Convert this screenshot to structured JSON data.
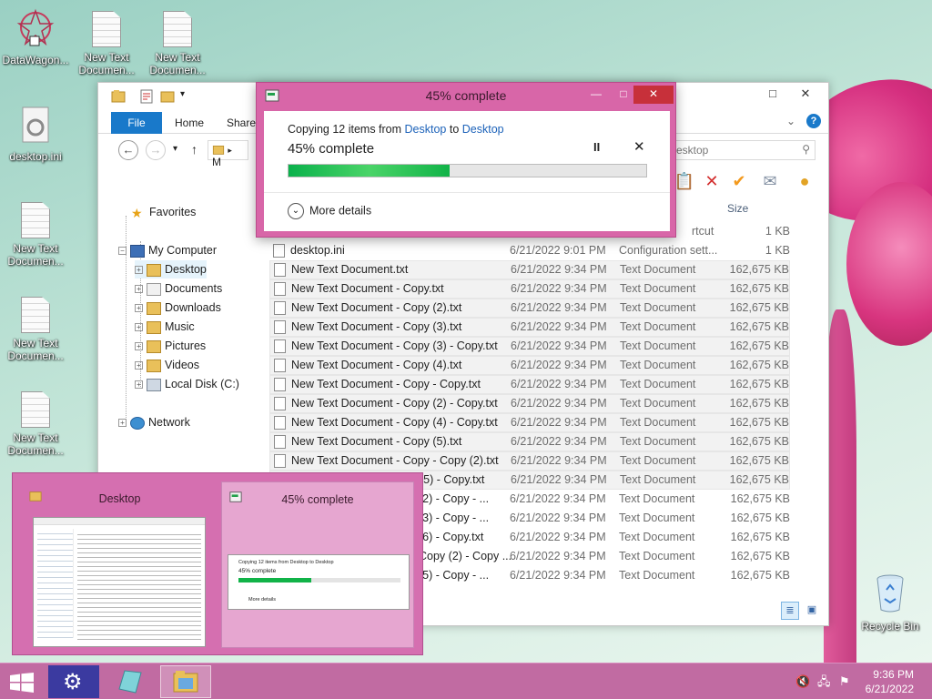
{
  "desktop": {
    "icons": [
      {
        "label": "DataWagon..."
      },
      {
        "label": "New Text Documen..."
      },
      {
        "label": "New Text Documen..."
      },
      {
        "label": "desktop.ini"
      },
      {
        "label": "New Text Documen..."
      },
      {
        "label": "New Text Documen..."
      },
      {
        "label": "New Text Documen..."
      }
    ],
    "recycle_bin": "Recycle Bin"
  },
  "explorer": {
    "ribbon_tabs": [
      "File",
      "Home",
      "Share"
    ],
    "address_partial": "M",
    "search_placeholder": "esktop",
    "col_size": "Size",
    "nav": {
      "favorites": "Favorites",
      "my_computer": "My Computer",
      "desktop": "Desktop",
      "documents": "Documents",
      "downloads": "Downloads",
      "music": "Music",
      "pictures": "Pictures",
      "videos": "Videos",
      "local_disk": "Local Disk (C:)",
      "network": "Network"
    },
    "partial_row": {
      "type": "rtcut",
      "size": "1 KB"
    },
    "files": [
      {
        "name": "desktop.ini",
        "date": "6/21/2022 9:01 PM",
        "type": "Configuration sett...",
        "size": "1 KB"
      },
      {
        "name": "New Text Document.txt",
        "date": "6/21/2022 9:34 PM",
        "type": "Text Document",
        "size": "162,675 KB"
      },
      {
        "name": "New Text Document - Copy.txt",
        "date": "6/21/2022 9:34 PM",
        "type": "Text Document",
        "size": "162,675 KB"
      },
      {
        "name": "New Text Document - Copy (2).txt",
        "date": "6/21/2022 9:34 PM",
        "type": "Text Document",
        "size": "162,675 KB"
      },
      {
        "name": "New Text Document - Copy (3).txt",
        "date": "6/21/2022 9:34 PM",
        "type": "Text Document",
        "size": "162,675 KB"
      },
      {
        "name": "New Text Document - Copy (3) - Copy.txt",
        "date": "6/21/2022 9:34 PM",
        "type": "Text Document",
        "size": "162,675 KB"
      },
      {
        "name": "New Text Document - Copy (4).txt",
        "date": "6/21/2022 9:34 PM",
        "type": "Text Document",
        "size": "162,675 KB"
      },
      {
        "name": "New Text Document - Copy - Copy.txt",
        "date": "6/21/2022 9:34 PM",
        "type": "Text Document",
        "size": "162,675 KB"
      },
      {
        "name": "New Text Document - Copy (2) - Copy.txt",
        "date": "6/21/2022 9:34 PM",
        "type": "Text Document",
        "size": "162,675 KB"
      },
      {
        "name": "New Text Document - Copy (4) - Copy.txt",
        "date": "6/21/2022 9:34 PM",
        "type": "Text Document",
        "size": "162,675 KB"
      },
      {
        "name": "New Text Document - Copy (5).txt",
        "date": "6/21/2022 9:34 PM",
        "type": "Text Document",
        "size": "162,675 KB"
      },
      {
        "name": "New Text Document - Copy - Copy (2).txt",
        "date": "6/21/2022 9:34 PM",
        "type": "Text Document",
        "size": "162,675 KB"
      },
      {
        "name": "(5) - Copy.txt",
        "date": "6/21/2022 9:34 PM",
        "type": "Text Document",
        "size": "162,675 KB"
      },
      {
        "name": "(2) - Copy - ...",
        "date": "6/21/2022 9:34 PM",
        "type": "Text Document",
        "size": "162,675 KB"
      },
      {
        "name": "(3) - Copy - ...",
        "date": "6/21/2022 9:34 PM",
        "type": "Text Document",
        "size": "162,675 KB"
      },
      {
        "name": "(6) - Copy.txt",
        "date": "6/21/2022 9:34 PM",
        "type": "Text Document",
        "size": "162,675 KB"
      },
      {
        "name": "Copy (2) - Copy ...",
        "date": "6/21/2022 9:34 PM",
        "type": "Text Document",
        "size": "162,675 KB"
      },
      {
        "name": "(5) - Copy - ...",
        "date": "6/21/2022 9:34 PM",
        "type": "Text Document",
        "size": "162,675 KB"
      }
    ]
  },
  "copy_dialog": {
    "title": "45% complete",
    "line_prefix": "Copying 12 items from ",
    "source": "Desktop",
    "line_mid": " to ",
    "dest": "Desktop",
    "status": "45% complete",
    "progress_fraction": 0.45,
    "pause_glyph": "II",
    "stop_glyph": "✕",
    "more_details": "More details"
  },
  "task_preview": {
    "desktop_title": "Desktop",
    "copy_title": "45% complete",
    "thumb_line1": "Copying 12 items from Desktop to Desktop",
    "thumb_line2": "45% complete",
    "thumb_more": "More details"
  },
  "taskbar": {
    "time": "9:36 PM",
    "date": "6/21/2022"
  },
  "colors": {
    "accent": "#1979ca",
    "dialog_frame": "#d866a8",
    "taskbar": "#c16ba2",
    "progress": "#0ab14b"
  }
}
